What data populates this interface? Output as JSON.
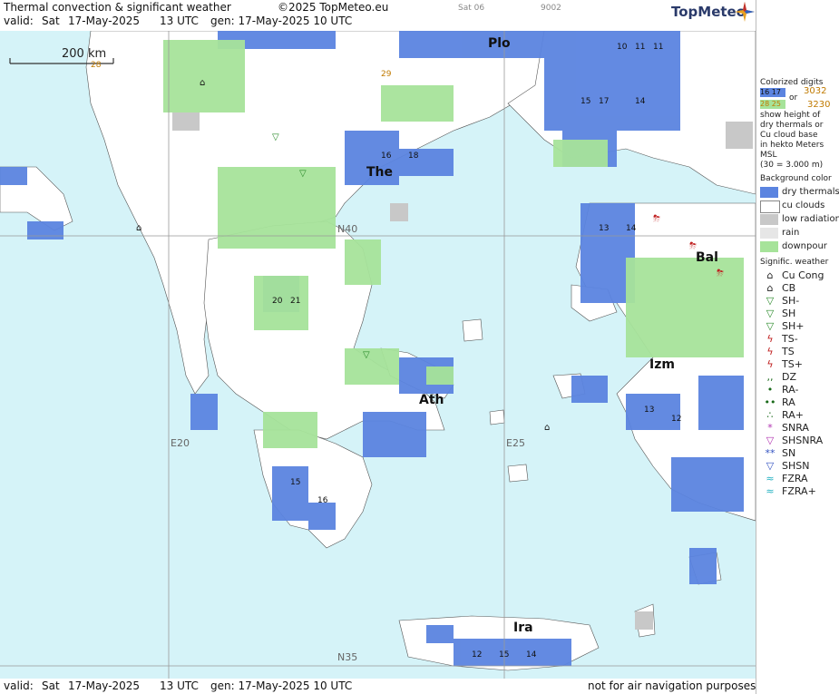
{
  "header": {
    "title": "Thermal convection & significant weather",
    "copyright": "©2025 TopMeteo.eu",
    "valid_label": "valid:",
    "valid_day": "Sat",
    "valid_date": "17-May-2025",
    "valid_time": "13 UTC",
    "gen": "gen: 17-May-2025 10 UTC",
    "small_1": "Sat 06",
    "small_2": "9002",
    "logo": "TopMeteo"
  },
  "footer": {
    "valid_label": "valid:",
    "valid_day": "Sat",
    "valid_date": "17-May-2025",
    "valid_time": "13 UTC",
    "gen": "gen: 17-May-2025 10 UTC",
    "note": "not for air navigation purposes"
  },
  "map": {
    "scale_label": "200 km",
    "grid_labels": [
      "N40",
      "N35",
      "E20",
      "E25"
    ],
    "cities": [
      "Plo",
      "The",
      "Ath",
      "Izm",
      "Bal",
      "Ira"
    ]
  },
  "legend": {
    "colorized_title": "Colorized digits",
    "example_a": "16 17",
    "example_b": "28 25",
    "or": "or",
    "example_c": "3032",
    "example_d": "3230",
    "desc": [
      "show height of",
      "dry thermals or",
      "Cu cloud base",
      "in hekto Meters",
      "MSL",
      "(30 = 3.000 m)"
    ],
    "bg_title": "Background color",
    "bg_items": [
      {
        "label": "dry thermals",
        "color": "#5b84e0"
      },
      {
        "label": "cu clouds",
        "color": "#ffffff"
      },
      {
        "label": "low radiation",
        "color": "#c8c8c8"
      },
      {
        "label": "rain",
        "color": "#e6e6e6"
      },
      {
        "label": "downpour",
        "color": "#a6e39a"
      }
    ],
    "wx_title": "Signific. weather",
    "wx_items": [
      {
        "label": "Cu Cong",
        "symbol": "cu-cong-icon"
      },
      {
        "label": "CB",
        "symbol": "cb-icon"
      },
      {
        "label": "SH-",
        "symbol": "shower-light-icon"
      },
      {
        "label": "SH",
        "symbol": "shower-icon"
      },
      {
        "label": "SH+",
        "symbol": "shower-heavy-icon"
      },
      {
        "label": "TS-",
        "symbol": "thunder-light-icon"
      },
      {
        "label": "TS",
        "symbol": "thunder-icon"
      },
      {
        "label": "TS+",
        "symbol": "thunder-heavy-icon"
      },
      {
        "label": "DZ",
        "symbol": "drizzle-icon"
      },
      {
        "label": "RA-",
        "symbol": "rain-light-icon"
      },
      {
        "label": "RA",
        "symbol": "rain-icon"
      },
      {
        "label": "RA+",
        "symbol": "rain-heavy-icon"
      },
      {
        "label": "SNRA",
        "symbol": "snow-rain-icon"
      },
      {
        "label": "SHSNRA",
        "symbol": "snow-rain-shower-icon"
      },
      {
        "label": "SN",
        "symbol": "snow-icon"
      },
      {
        "label": "SHSN",
        "symbol": "snow-shower-icon"
      },
      {
        "label": "FZRA",
        "symbol": "freezing-rain-icon"
      },
      {
        "label": "FZRA+",
        "symbol": "freezing-rain-heavy-icon"
      }
    ]
  }
}
